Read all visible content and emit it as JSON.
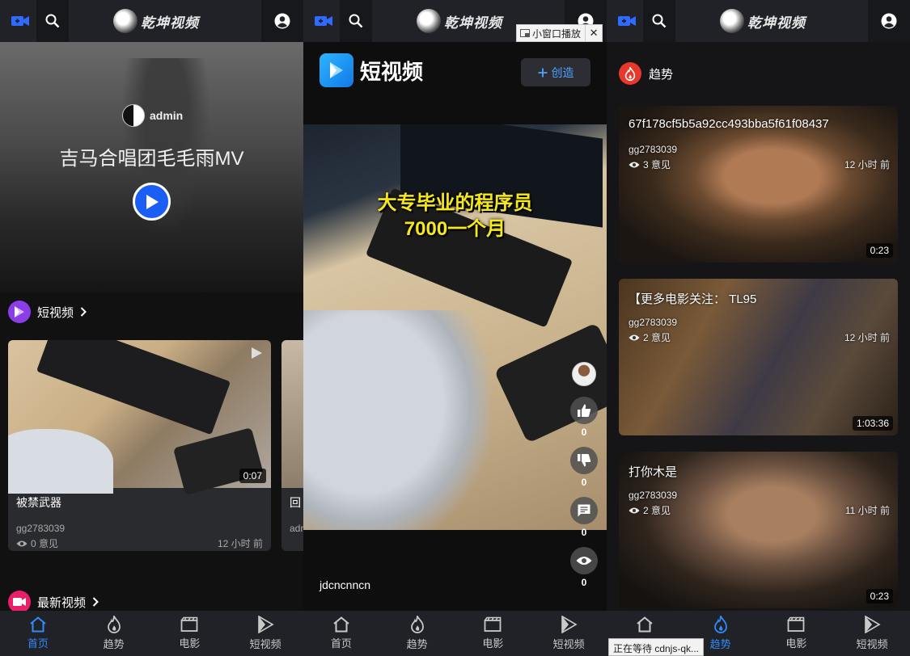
{
  "app": {
    "logo_text": "乾坤视频"
  },
  "colors": {
    "accent": "#2f8cff",
    "play": "#1a5ef5",
    "short_video": "#8b3ee6",
    "latest": "#ea1f6a",
    "trending": "#e8372b",
    "create_text": "#4da3ff"
  },
  "nav": [
    {
      "label": "首页",
      "icon": "home-icon"
    },
    {
      "label": "趋势",
      "icon": "flame-icon"
    },
    {
      "label": "电影",
      "icon": "clapperboard-icon"
    },
    {
      "label": "短视频",
      "icon": "short-video-icon"
    }
  ],
  "screen1": {
    "hero": {
      "username": "admin",
      "title": "吉马合唱团毛毛雨MV"
    },
    "short_section": {
      "title": "短视频"
    },
    "cards": [
      {
        "title": "被禁武器",
        "author": "gg2783039",
        "views": "0 意见",
        "time": "12 小时 前",
        "duration": "0:07"
      },
      {
        "title": "回",
        "author": "adr"
      }
    ],
    "latest_section": {
      "title": "最新视频"
    }
  },
  "screen2": {
    "tooltip": "小窗口播放",
    "tooltip_close": "✕",
    "header": {
      "title": "短视频",
      "create_label": "创造"
    },
    "video": {
      "caption_line1": "大专毕业的程序员",
      "caption_line2": "7000一个月",
      "username": "jdcncnncn",
      "likes": "0",
      "dislikes": "0",
      "comments": "0",
      "views": "0"
    }
  },
  "screen3": {
    "section_title": "趋势",
    "status_text": "正在等待 cdnjs-qk...",
    "cards": [
      {
        "title": "67f178cf5b5a92cc493bba5f61f08437",
        "author": "gg2783039",
        "views": "3 意见",
        "time": "12 小时 前",
        "duration": "0:23"
      },
      {
        "title": "【更多电影关注： TL95",
        "author": "gg2783039",
        "views": "2 意见",
        "time": "12 小时 前",
        "duration": "1:03:36"
      },
      {
        "title": "打你木是",
        "author": "gg2783039",
        "views": "2 意见",
        "time": "11 小时 前",
        "duration": "0:23"
      }
    ]
  }
}
